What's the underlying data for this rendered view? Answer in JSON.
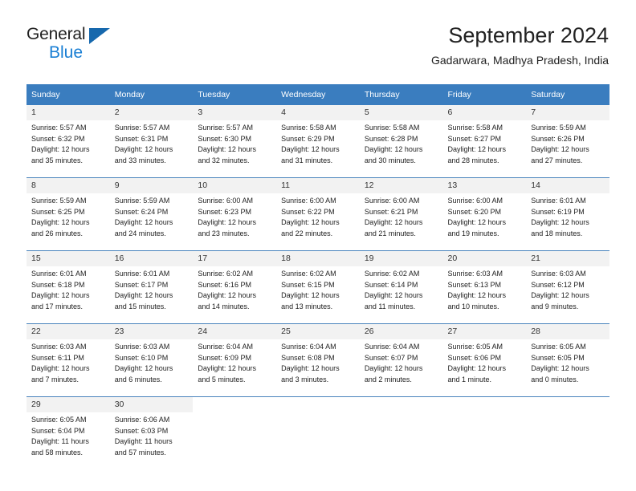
{
  "brand": {
    "name_part1": "General",
    "name_part2": "Blue",
    "logo_icon": "triangle-flag-icon"
  },
  "header": {
    "title": "September 2024",
    "subtitle": "Gadarwara, Madhya Pradesh, India"
  },
  "colors": {
    "header_blue": "#3a7dbf",
    "row_divider": "#4a84bd",
    "date_strip": "#f2f2f2",
    "brand_blue": "#1a7fd4",
    "logo_blue": "#1668ad",
    "text": "#222222"
  },
  "calendar": {
    "weekday_headers": [
      "Sunday",
      "Monday",
      "Tuesday",
      "Wednesday",
      "Thursday",
      "Friday",
      "Saturday"
    ],
    "weeks": [
      [
        {
          "date": "1",
          "sunrise": "Sunrise: 5:57 AM",
          "sunset": "Sunset: 6:32 PM",
          "daylight_line1": "Daylight: 12 hours",
          "daylight_line2": "and 35 minutes."
        },
        {
          "date": "2",
          "sunrise": "Sunrise: 5:57 AM",
          "sunset": "Sunset: 6:31 PM",
          "daylight_line1": "Daylight: 12 hours",
          "daylight_line2": "and 33 minutes."
        },
        {
          "date": "3",
          "sunrise": "Sunrise: 5:57 AM",
          "sunset": "Sunset: 6:30 PM",
          "daylight_line1": "Daylight: 12 hours",
          "daylight_line2": "and 32 minutes."
        },
        {
          "date": "4",
          "sunrise": "Sunrise: 5:58 AM",
          "sunset": "Sunset: 6:29 PM",
          "daylight_line1": "Daylight: 12 hours",
          "daylight_line2": "and 31 minutes."
        },
        {
          "date": "5",
          "sunrise": "Sunrise: 5:58 AM",
          "sunset": "Sunset: 6:28 PM",
          "daylight_line1": "Daylight: 12 hours",
          "daylight_line2": "and 30 minutes."
        },
        {
          "date": "6",
          "sunrise": "Sunrise: 5:58 AM",
          "sunset": "Sunset: 6:27 PM",
          "daylight_line1": "Daylight: 12 hours",
          "daylight_line2": "and 28 minutes."
        },
        {
          "date": "7",
          "sunrise": "Sunrise: 5:59 AM",
          "sunset": "Sunset: 6:26 PM",
          "daylight_line1": "Daylight: 12 hours",
          "daylight_line2": "and 27 minutes."
        }
      ],
      [
        {
          "date": "8",
          "sunrise": "Sunrise: 5:59 AM",
          "sunset": "Sunset: 6:25 PM",
          "daylight_line1": "Daylight: 12 hours",
          "daylight_line2": "and 26 minutes."
        },
        {
          "date": "9",
          "sunrise": "Sunrise: 5:59 AM",
          "sunset": "Sunset: 6:24 PM",
          "daylight_line1": "Daylight: 12 hours",
          "daylight_line2": "and 24 minutes."
        },
        {
          "date": "10",
          "sunrise": "Sunrise: 6:00 AM",
          "sunset": "Sunset: 6:23 PM",
          "daylight_line1": "Daylight: 12 hours",
          "daylight_line2": "and 23 minutes."
        },
        {
          "date": "11",
          "sunrise": "Sunrise: 6:00 AM",
          "sunset": "Sunset: 6:22 PM",
          "daylight_line1": "Daylight: 12 hours",
          "daylight_line2": "and 22 minutes."
        },
        {
          "date": "12",
          "sunrise": "Sunrise: 6:00 AM",
          "sunset": "Sunset: 6:21 PM",
          "daylight_line1": "Daylight: 12 hours",
          "daylight_line2": "and 21 minutes."
        },
        {
          "date": "13",
          "sunrise": "Sunrise: 6:00 AM",
          "sunset": "Sunset: 6:20 PM",
          "daylight_line1": "Daylight: 12 hours",
          "daylight_line2": "and 19 minutes."
        },
        {
          "date": "14",
          "sunrise": "Sunrise: 6:01 AM",
          "sunset": "Sunset: 6:19 PM",
          "daylight_line1": "Daylight: 12 hours",
          "daylight_line2": "and 18 minutes."
        }
      ],
      [
        {
          "date": "15",
          "sunrise": "Sunrise: 6:01 AM",
          "sunset": "Sunset: 6:18 PM",
          "daylight_line1": "Daylight: 12 hours",
          "daylight_line2": "and 17 minutes."
        },
        {
          "date": "16",
          "sunrise": "Sunrise: 6:01 AM",
          "sunset": "Sunset: 6:17 PM",
          "daylight_line1": "Daylight: 12 hours",
          "daylight_line2": "and 15 minutes."
        },
        {
          "date": "17",
          "sunrise": "Sunrise: 6:02 AM",
          "sunset": "Sunset: 6:16 PM",
          "daylight_line1": "Daylight: 12 hours",
          "daylight_line2": "and 14 minutes."
        },
        {
          "date": "18",
          "sunrise": "Sunrise: 6:02 AM",
          "sunset": "Sunset: 6:15 PM",
          "daylight_line1": "Daylight: 12 hours",
          "daylight_line2": "and 13 minutes."
        },
        {
          "date": "19",
          "sunrise": "Sunrise: 6:02 AM",
          "sunset": "Sunset: 6:14 PM",
          "daylight_line1": "Daylight: 12 hours",
          "daylight_line2": "and 11 minutes."
        },
        {
          "date": "20",
          "sunrise": "Sunrise: 6:03 AM",
          "sunset": "Sunset: 6:13 PM",
          "daylight_line1": "Daylight: 12 hours",
          "daylight_line2": "and 10 minutes."
        },
        {
          "date": "21",
          "sunrise": "Sunrise: 6:03 AM",
          "sunset": "Sunset: 6:12 PM",
          "daylight_line1": "Daylight: 12 hours",
          "daylight_line2": "and 9 minutes."
        }
      ],
      [
        {
          "date": "22",
          "sunrise": "Sunrise: 6:03 AM",
          "sunset": "Sunset: 6:11 PM",
          "daylight_line1": "Daylight: 12 hours",
          "daylight_line2": "and 7 minutes."
        },
        {
          "date": "23",
          "sunrise": "Sunrise: 6:03 AM",
          "sunset": "Sunset: 6:10 PM",
          "daylight_line1": "Daylight: 12 hours",
          "daylight_line2": "and 6 minutes."
        },
        {
          "date": "24",
          "sunrise": "Sunrise: 6:04 AM",
          "sunset": "Sunset: 6:09 PM",
          "daylight_line1": "Daylight: 12 hours",
          "daylight_line2": "and 5 minutes."
        },
        {
          "date": "25",
          "sunrise": "Sunrise: 6:04 AM",
          "sunset": "Sunset: 6:08 PM",
          "daylight_line1": "Daylight: 12 hours",
          "daylight_line2": "and 3 minutes."
        },
        {
          "date": "26",
          "sunrise": "Sunrise: 6:04 AM",
          "sunset": "Sunset: 6:07 PM",
          "daylight_line1": "Daylight: 12 hours",
          "daylight_line2": "and 2 minutes."
        },
        {
          "date": "27",
          "sunrise": "Sunrise: 6:05 AM",
          "sunset": "Sunset: 6:06 PM",
          "daylight_line1": "Daylight: 12 hours",
          "daylight_line2": "and 1 minute."
        },
        {
          "date": "28",
          "sunrise": "Sunrise: 6:05 AM",
          "sunset": "Sunset: 6:05 PM",
          "daylight_line1": "Daylight: 12 hours",
          "daylight_line2": "and 0 minutes."
        }
      ],
      [
        {
          "date": "29",
          "sunrise": "Sunrise: 6:05 AM",
          "sunset": "Sunset: 6:04 PM",
          "daylight_line1": "Daylight: 11 hours",
          "daylight_line2": "and 58 minutes."
        },
        {
          "date": "30",
          "sunrise": "Sunrise: 6:06 AM",
          "sunset": "Sunset: 6:03 PM",
          "daylight_line1": "Daylight: 11 hours",
          "daylight_line2": "and 57 minutes."
        },
        {
          "date": "",
          "sunrise": "",
          "sunset": "",
          "daylight_line1": "",
          "daylight_line2": ""
        },
        {
          "date": "",
          "sunrise": "",
          "sunset": "",
          "daylight_line1": "",
          "daylight_line2": ""
        },
        {
          "date": "",
          "sunrise": "",
          "sunset": "",
          "daylight_line1": "",
          "daylight_line2": ""
        },
        {
          "date": "",
          "sunrise": "",
          "sunset": "",
          "daylight_line1": "",
          "daylight_line2": ""
        },
        {
          "date": "",
          "sunrise": "",
          "sunset": "",
          "daylight_line1": "",
          "daylight_line2": ""
        }
      ]
    ]
  }
}
